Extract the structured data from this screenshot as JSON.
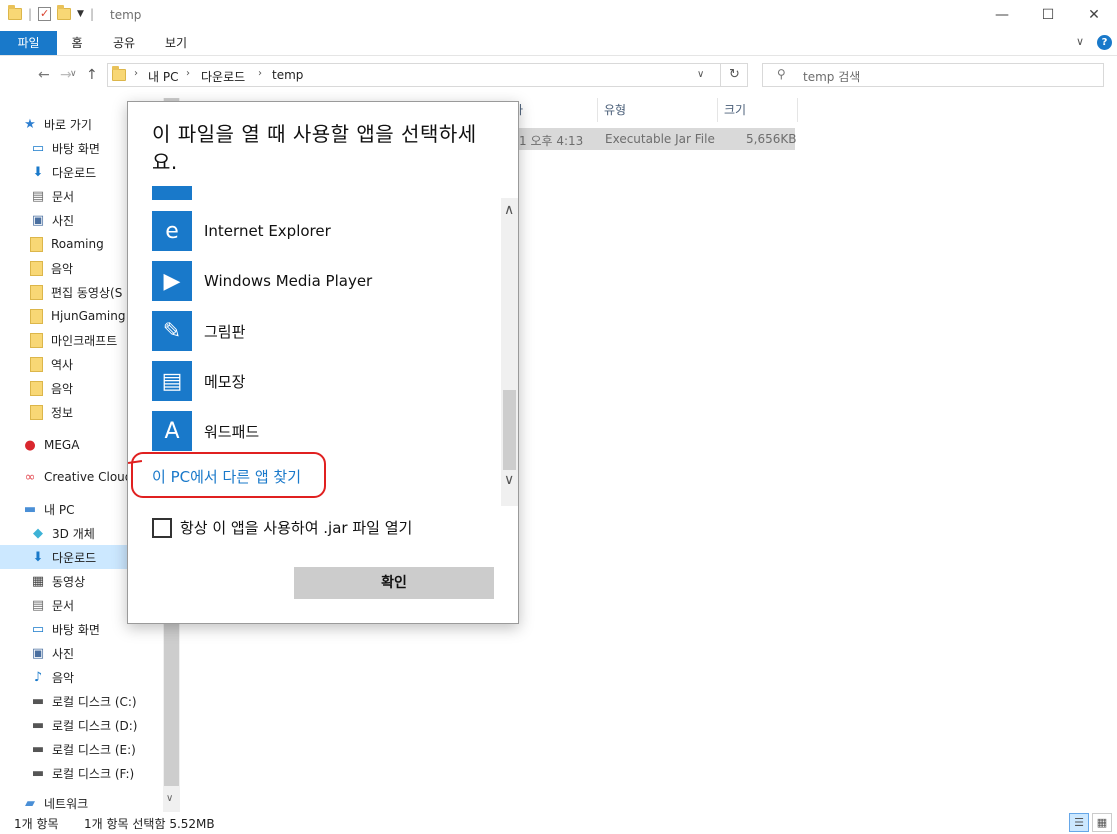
{
  "window": {
    "title": "temp",
    "minimize": "—",
    "maximize": "☐",
    "close": "✕"
  },
  "ribbon": {
    "tabs": [
      "파일",
      "홈",
      "공유",
      "보기"
    ],
    "expand": "∨",
    "help": "?"
  },
  "nav": {
    "back": "←",
    "forward": "→",
    "recent": "∨",
    "up": "↑",
    "breadcrumbs": [
      "내 PC",
      "다운로드",
      "temp"
    ],
    "crumb_sep": "›",
    "address_drop": "∨",
    "refresh": "↻",
    "search_icon": "search-icon",
    "search_placeholder": "temp 검색"
  },
  "sidebar": {
    "items": [
      {
        "label": "바로 가기",
        "icon": "star-icon",
        "glyph": "★",
        "color": "#2f7fd0"
      },
      {
        "label": "바탕 화면",
        "icon": "desktop-icon",
        "glyph": "▭",
        "color": "#1979ca"
      },
      {
        "label": "다운로드",
        "icon": "download-icon",
        "glyph": "⬇",
        "color": "#1979ca"
      },
      {
        "label": "문서",
        "icon": "document-icon",
        "glyph": "▤",
        "color": "#6d6d6d"
      },
      {
        "label": "사진",
        "icon": "pictures-icon",
        "glyph": "▣",
        "color": "#4a6fa0"
      },
      {
        "label": "Roaming",
        "icon": "folder-icon"
      },
      {
        "label": "음악",
        "icon": "folder-icon"
      },
      {
        "label": "편집 동영상(S",
        "icon": "folder-icon"
      },
      {
        "label": "HjunGaming",
        "icon": "folder-icon"
      },
      {
        "label": "마인크래프트",
        "icon": "folder-icon"
      },
      {
        "label": "역사",
        "icon": "folder-icon"
      },
      {
        "label": "음악",
        "icon": "folder-icon"
      },
      {
        "label": "정보",
        "icon": "folder-icon"
      },
      {
        "label": "MEGA",
        "icon": "mega-icon",
        "glyph": "●",
        "color": "#d9272e"
      },
      {
        "label": "Creative Cloud",
        "icon": "creative-cloud-icon",
        "glyph": "∞",
        "color": "#e34850"
      },
      {
        "label": "내 PC",
        "icon": "computer-icon",
        "glyph": "▬",
        "color": "#4a8fd6"
      },
      {
        "label": "3D 개체",
        "icon": "3d-objects-icon",
        "glyph": "◆",
        "color": "#3db2d6"
      },
      {
        "label": "다운로드",
        "icon": "download-icon",
        "glyph": "⬇",
        "color": "#1979ca"
      },
      {
        "label": "동영상",
        "icon": "video-icon",
        "glyph": "▦",
        "color": "#444"
      },
      {
        "label": "문서",
        "icon": "document-icon",
        "glyph": "▤",
        "color": "#6d6d6d"
      },
      {
        "label": "바탕 화면",
        "icon": "desktop-icon",
        "glyph": "▭",
        "color": "#1979ca"
      },
      {
        "label": "사진",
        "icon": "pictures-icon",
        "glyph": "▣",
        "color": "#4a6fa0"
      },
      {
        "label": "음악",
        "icon": "music-icon",
        "glyph": "♪",
        "color": "#1979ca"
      },
      {
        "label": "로컬 디스크 (C:)",
        "icon": "drive-icon",
        "glyph": "▬",
        "color": "#555"
      },
      {
        "label": "로컬 디스크 (D:)",
        "icon": "drive-icon",
        "glyph": "▬",
        "color": "#555"
      },
      {
        "label": "로컬 디스크 (E:)",
        "icon": "drive-icon",
        "glyph": "▬",
        "color": "#555"
      },
      {
        "label": "로컬 디스크 (F:)",
        "icon": "drive-icon",
        "glyph": "▬",
        "color": "#555"
      },
      {
        "label": "네트워크",
        "icon": "network-icon",
        "glyph": "▰",
        "color": "#4a8fd6"
      }
    ],
    "selected_label": "다운로드",
    "scroll_down": "∨"
  },
  "filelist": {
    "columns": [
      "자",
      "유형",
      "크기"
    ],
    "row": {
      "date": "1 오후 4:13",
      "type": "Executable Jar File",
      "size": "5,656KB"
    }
  },
  "status": {
    "count": "1개 항목",
    "selection": "1개 항목 선택함 5.52MB"
  },
  "dialog": {
    "title": "이 파일을 열 때 사용할 앱을 선택하세요.",
    "apps": [
      {
        "label": "Internet Explorer",
        "icon": "internet-explorer-icon",
        "glyph": "e"
      },
      {
        "label": "Windows Media Player",
        "icon": "windows-media-player-icon",
        "glyph": "▶"
      },
      {
        "label": "그림판",
        "icon": "paint-icon",
        "glyph": "✎"
      },
      {
        "label": "메모장",
        "icon": "notepad-icon",
        "glyph": "▤"
      },
      {
        "label": "워드패드",
        "icon": "wordpad-icon",
        "glyph": "A"
      }
    ],
    "find_link": "이 PC에서 다른 앱 찾기",
    "always_label": "항상 이 앱을 사용하여 .jar 파일 열기",
    "ok": "확인",
    "scroll_up": "∧",
    "scroll_down": "∨"
  },
  "colors": {
    "accent": "#1979ca",
    "selection": "#cce8ff",
    "annotation": "#e02020"
  }
}
